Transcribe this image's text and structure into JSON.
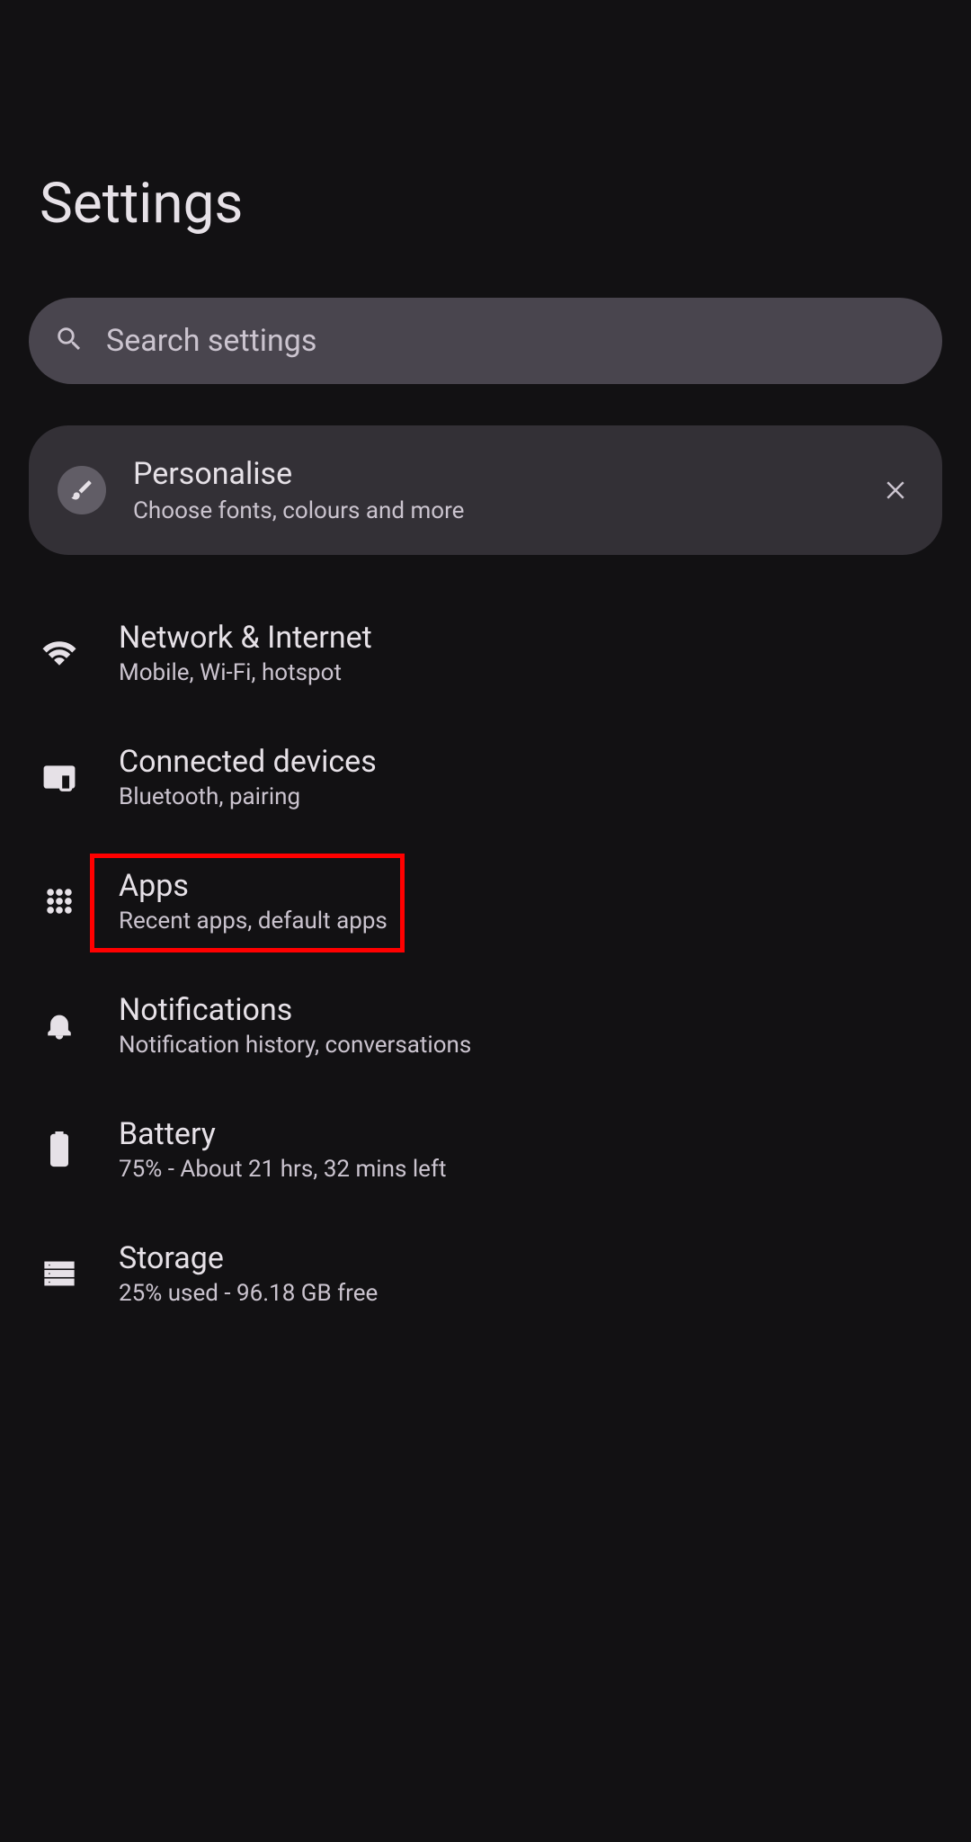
{
  "page_title": "Settings",
  "search": {
    "placeholder": "Search settings"
  },
  "promo": {
    "title": "Personalise",
    "subtitle": "Choose fonts, colours and more",
    "icon": "brush-icon"
  },
  "items": [
    {
      "icon": "wifi-icon",
      "title": "Network & Internet",
      "subtitle": "Mobile, Wi-Fi, hotspot",
      "highlighted": false
    },
    {
      "icon": "devices-icon",
      "title": "Connected devices",
      "subtitle": "Bluetooth, pairing",
      "highlighted": false
    },
    {
      "icon": "apps-icon",
      "title": "Apps",
      "subtitle": "Recent apps, default apps",
      "highlighted": true
    },
    {
      "icon": "bell-icon",
      "title": "Notifications",
      "subtitle": "Notification history, conversations",
      "highlighted": false
    },
    {
      "icon": "battery-icon",
      "title": "Battery",
      "subtitle": "75% - About 21 hrs, 32 mins left",
      "highlighted": false
    },
    {
      "icon": "storage-icon",
      "title": "Storage",
      "subtitle": "25% used - 96.18 GB free",
      "highlighted": false
    }
  ]
}
